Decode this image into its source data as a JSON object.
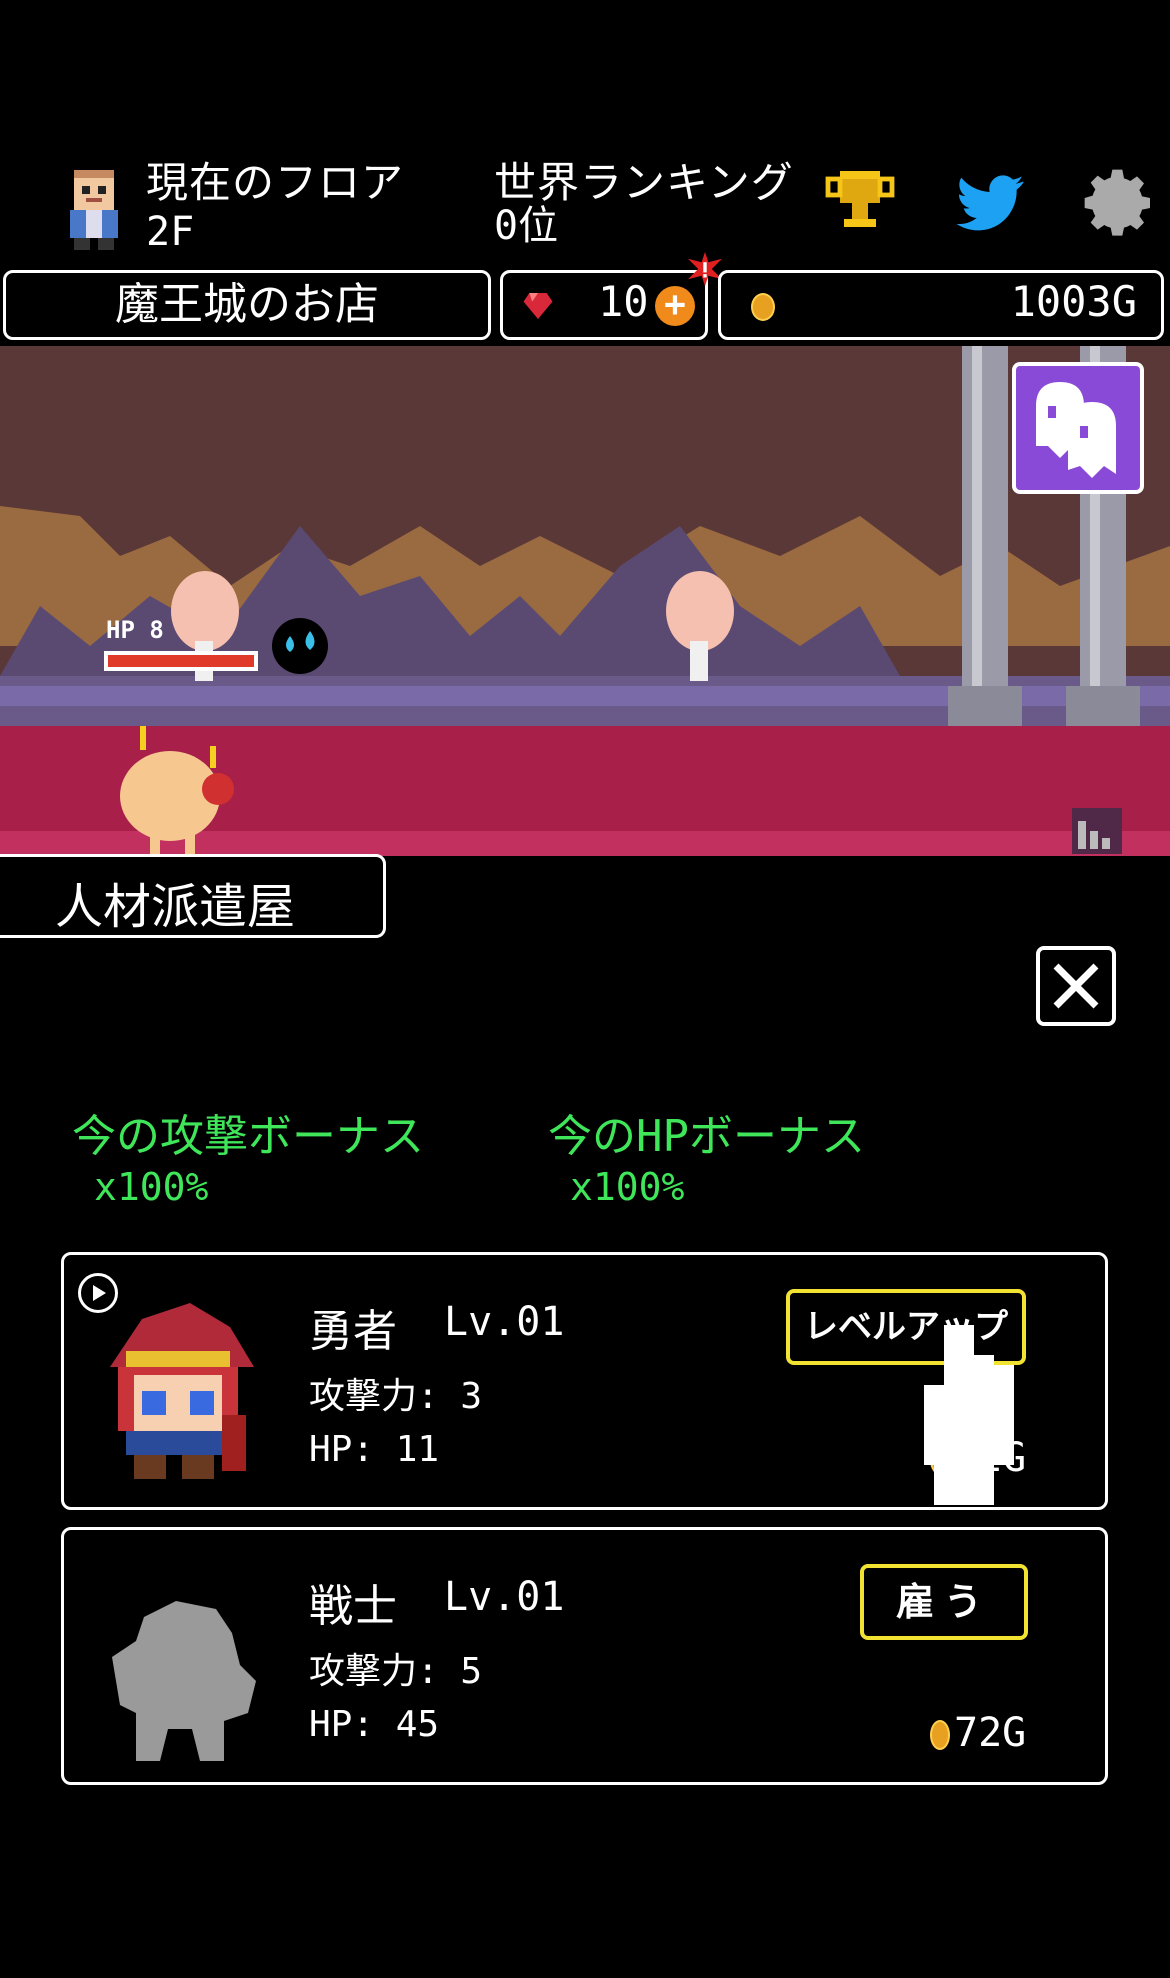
{
  "header": {
    "floor_label": "現在のフロア",
    "floor_value": "2F",
    "ranking_label": "世界ランキング",
    "ranking_value": "0位"
  },
  "icons": {
    "avatar": "player-avatar-icon",
    "trophy": "trophy-icon",
    "twitter": "twitter-bird-icon",
    "settings": "gear-icon",
    "gem": "red-gem-icon",
    "plus": "plus-icon",
    "coin": "gold-coin-icon"
  },
  "resources": {
    "shop_label": "魔王城のお店",
    "gems": "10",
    "gold": "1003G"
  },
  "scene": {
    "enemy_hp_label": "HP 8",
    "enemy_hp_fraction": 1.0
  },
  "panel": {
    "tab_title": "人材派遣屋",
    "attack_bonus_label": "今の攻撃ボーナス",
    "attack_bonus_value": "x100%",
    "hp_bonus_label": "今のHPボーナス",
    "hp_bonus_value": "x100%"
  },
  "units": [
    {
      "name": "勇者",
      "level": "Lv.01",
      "attack": "攻撃力: 3",
      "hp": "HP: 11",
      "button": "レベルアップ",
      "price": "32G"
    },
    {
      "name": "戦士",
      "level": "Lv.01",
      "attack": "攻撃力: 5",
      "hp": "HP: 45",
      "button": "雇う",
      "price": "72G"
    }
  ],
  "colors": {
    "bonus_text": "#3fe65a",
    "button_border": "#f2e232",
    "cave_floor": "#a8204a",
    "cave_wall": "#5a3838",
    "ghost_button": "#8a4ad8"
  }
}
